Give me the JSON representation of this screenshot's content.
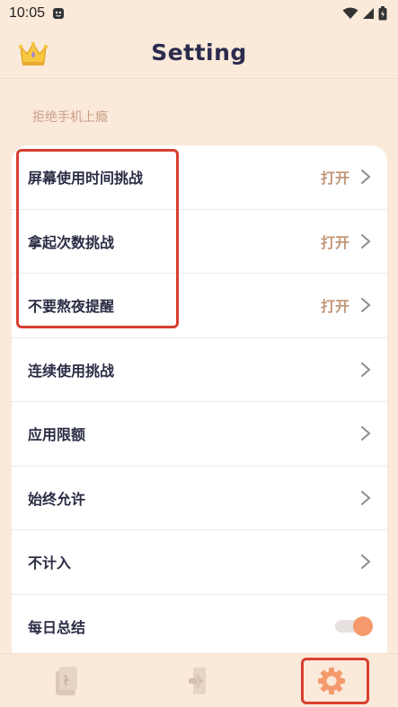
{
  "status_bar": {
    "time": "10:05",
    "icons": [
      "app-notification-icon",
      "wifi-icon",
      "signal-icon",
      "battery-icon"
    ]
  },
  "header": {
    "title": "Setting",
    "left_icon": "crown-icon"
  },
  "section": {
    "label": "拒绝手机上瘾"
  },
  "rows": [
    {
      "label": "屏幕使用时间挑战",
      "value": "打开",
      "type": "chevron"
    },
    {
      "label": "拿起次数挑战",
      "value": "打开",
      "type": "chevron"
    },
    {
      "label": "不要熬夜提醒",
      "value": "打开",
      "type": "chevron"
    },
    {
      "label": "连续使用挑战",
      "value": "",
      "type": "chevron"
    },
    {
      "label": "应用限额",
      "value": "",
      "type": "chevron"
    },
    {
      "label": "始终允许",
      "value": "",
      "type": "chevron"
    },
    {
      "label": "不计入",
      "value": "",
      "type": "chevron"
    },
    {
      "label": "每日总结",
      "value": "",
      "type": "toggle",
      "toggle_on": true
    }
  ],
  "bottom_nav": {
    "items": [
      "phone-icon",
      "exit-door-icon",
      "gear-icon"
    ],
    "active": "gear-icon"
  },
  "colors": {
    "background": "#FBE9DA",
    "accent": "#F49A6C",
    "value_text": "#C4977A",
    "highlight": "#D8402F"
  }
}
